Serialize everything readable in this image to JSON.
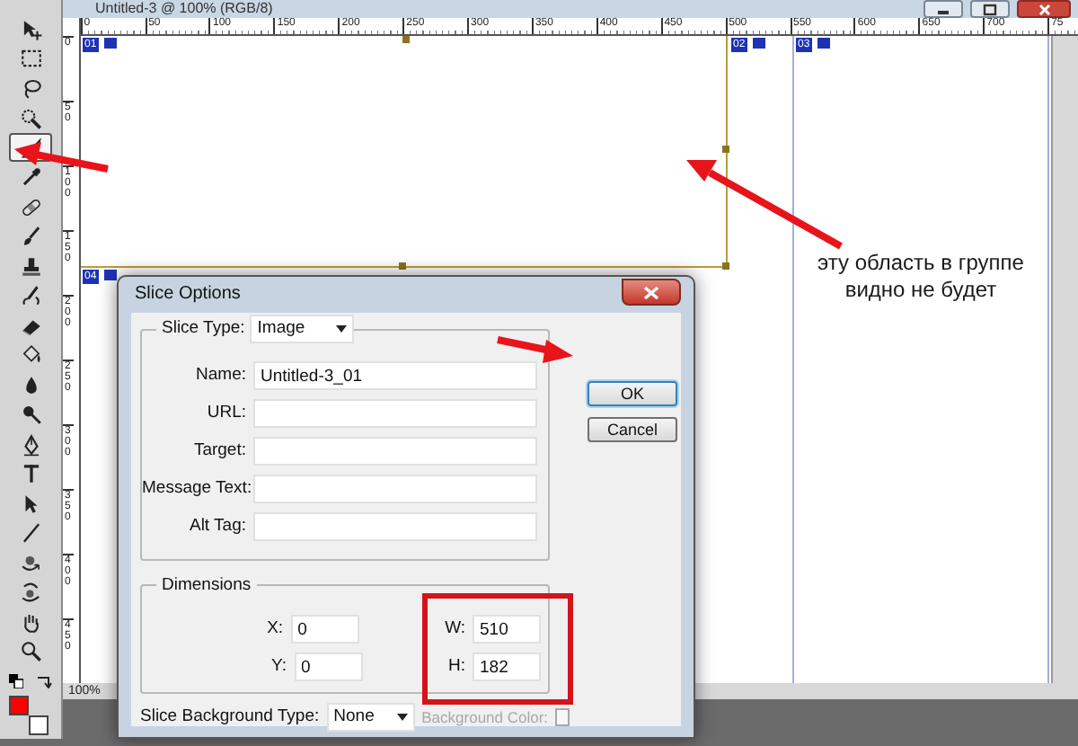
{
  "window": {
    "title": "Untitled-3 @ 100% (RGB/8)"
  },
  "tools": [
    {
      "kind": "move",
      "selected": false
    },
    {
      "kind": "marquee",
      "selected": false
    },
    {
      "kind": "lasso",
      "selected": false
    },
    {
      "kind": "quick_select",
      "selected": false
    },
    {
      "kind": "slice",
      "selected": true
    },
    {
      "kind": "eyedropper",
      "selected": false
    },
    {
      "kind": "healing",
      "selected": false
    },
    {
      "kind": "brush",
      "selected": false
    },
    {
      "kind": "stamp",
      "selected": false
    },
    {
      "kind": "history",
      "selected": false
    },
    {
      "kind": "eraser",
      "selected": false
    },
    {
      "kind": "bucket",
      "selected": false
    },
    {
      "kind": "blur",
      "selected": false
    },
    {
      "kind": "dodge",
      "selected": false
    },
    {
      "kind": "pen",
      "selected": false
    },
    {
      "kind": "type",
      "selected": false
    },
    {
      "kind": "path_select",
      "selected": false
    },
    {
      "kind": "line",
      "selected": false
    },
    {
      "kind": "rotate3d",
      "selected": false
    },
    {
      "kind": "orbit3d",
      "selected": false
    },
    {
      "kind": "hand",
      "selected": false
    },
    {
      "kind": "zoom",
      "selected": false
    }
  ],
  "color_swatches": [
    {
      "color": "#ff0000"
    },
    {
      "color": "#ffffff"
    }
  ],
  "ruler_horizontal": [
    "0",
    "50",
    "100",
    "150",
    "200",
    "250",
    "300",
    "350",
    "400",
    "450",
    "500",
    "550",
    "600",
    "650",
    "700",
    "75"
  ],
  "ruler_vertical": [
    "0",
    "50",
    "100",
    "150",
    "200",
    "250",
    "300",
    "350",
    "400",
    "450"
  ],
  "slices": [
    {
      "number": "01"
    },
    {
      "number": "02"
    },
    {
      "number": "03"
    },
    {
      "number": "04"
    }
  ],
  "status_bar": {
    "zoom": "100%"
  },
  "dialog": {
    "title": "Slice Options",
    "slice_type": {
      "label": "Slice Type:",
      "value": "Image"
    },
    "fields": [
      {
        "label": "Name:",
        "value": "Untitled-3_01"
      },
      {
        "label": "URL:"
      },
      {
        "label": "Target:"
      },
      {
        "label": "Message Text:"
      },
      {
        "label": "Alt Tag:"
      }
    ],
    "dimensions": {
      "legend": "Dimensions",
      "x": {
        "label": "X:",
        "value": "0"
      },
      "y": {
        "label": "Y:",
        "value": "0"
      },
      "w": {
        "label": "W:",
        "value": "510"
      },
      "h": {
        "label": "H:",
        "value": "182"
      }
    },
    "background_type": {
      "label": "Slice Background Type:",
      "value": "None"
    },
    "background_color": {
      "label": "Background Color:",
      "disabled": true
    },
    "buttons": [
      {
        "label": "OK",
        "default": true
      },
      {
        "label": "Cancel",
        "default": false
      }
    ]
  },
  "annotation": {
    "text": "эту область в группе видно не будет"
  }
}
